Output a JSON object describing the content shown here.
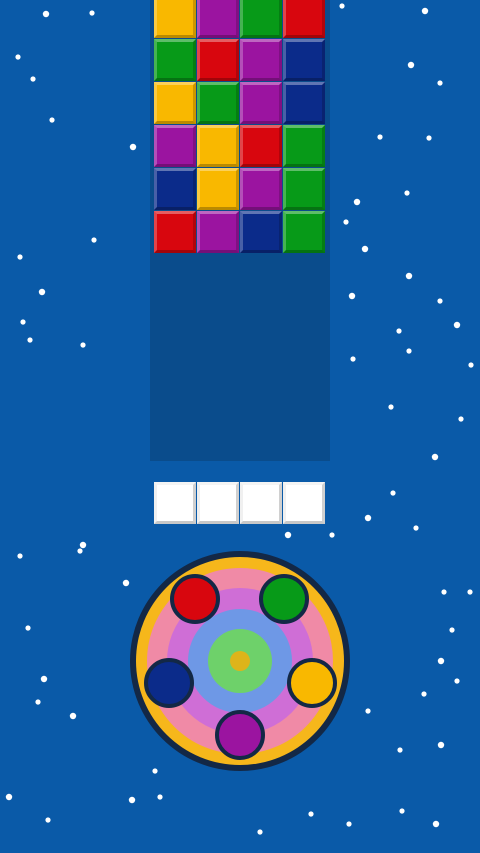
{
  "colors": {
    "background": "#0a5aa8",
    "board": "#0a4c8c",
    "yellow": "#f9b800",
    "purple": "#9b14a0",
    "green": "#079a18",
    "red": "#d8060e",
    "navy": "#0b2b8a",
    "slot": "#ffffff"
  },
  "board": {
    "rows": [
      [
        "yellow",
        "purple",
        "green",
        "red"
      ],
      [
        "green",
        "red",
        "purple",
        "navy"
      ],
      [
        "yellow",
        "green",
        "purple",
        "navy"
      ],
      [
        "purple",
        "yellow",
        "red",
        "green"
      ],
      [
        "navy",
        "yellow",
        "purple",
        "green"
      ],
      [
        "red",
        "purple",
        "navy",
        "green"
      ]
    ]
  },
  "slots": {
    "count": 4
  },
  "wheel": {
    "buttons": [
      "red",
      "green",
      "yellow",
      "purple",
      "navy"
    ]
  }
}
